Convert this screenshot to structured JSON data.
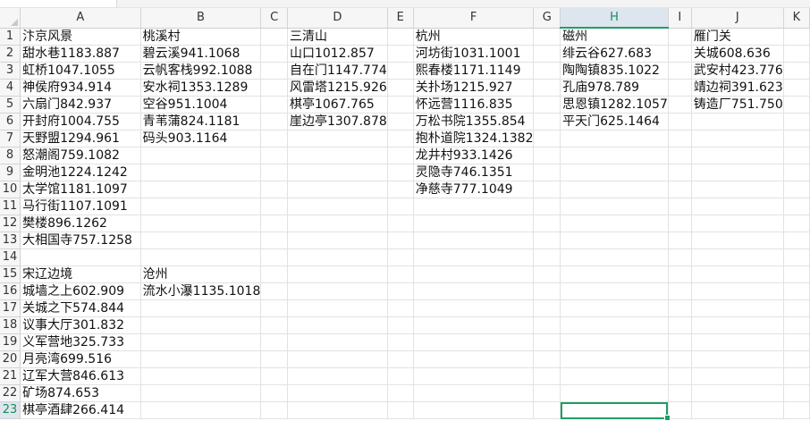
{
  "columns": [
    "A",
    "B",
    "C",
    "D",
    "E",
    "F",
    "G",
    "H",
    "I",
    "J",
    "K"
  ],
  "rows": [
    "1",
    "2",
    "3",
    "4",
    "5",
    "6",
    "7",
    "8",
    "9",
    "10",
    "11",
    "12",
    "13",
    "14",
    "15",
    "16",
    "17",
    "18",
    "19",
    "20",
    "21",
    "22",
    "23"
  ],
  "active_cell": "H23",
  "cells": {
    "A1": "汴京风景",
    "B1": "桃溪村",
    "D1": "三清山",
    "F1": "杭州",
    "H1": "磁州",
    "J1": "雁门关",
    "A2": "甜水巷1183.887",
    "B2": "碧云溪941.1068",
    "D2": "山口1012.857",
    "F2": "河坊街1031.1001",
    "H2": "绯云谷627.683",
    "J2": "关城608.636",
    "A3": "虹桥1047.1055",
    "B3": "云帆客栈992.1088",
    "D3": "自在门1147.774",
    "F3": "熙春楼1171.1149",
    "H3": "陶陶镇835.1022",
    "J3": "武安村423.776",
    "A4": "神侯府934.914",
    "B4": "安水祠1353.1289",
    "D4": "风雷塔1215.926",
    "F4": "关扑场1215.927",
    "H4": "孔庙978.789",
    "J4": "靖边祠391.623",
    "A5": "六扇门842.937",
    "B5": "空谷951.1004",
    "D5": "棋亭1067.765",
    "F5": "怀远营1116.835",
    "H5": "思恩镇1282.1057",
    "J5": "铸造厂751.750",
    "A6": "开封府1004.755",
    "B6": "青苇蒲824.1181",
    "D6": "崖边亭1307.878",
    "F6": "万松书院1355.854",
    "H6": "平天门625.1464",
    "A7": "天野盟1294.961",
    "B7": "码头903.1164",
    "F7": "抱朴道院1324.1382",
    "A8": "怒潮阁759.1082",
    "F8": "龙井村933.1426",
    "A9": "金明池1224.1242",
    "F9": "灵隐寺746.1351",
    "A10": "太学馆1181.1097",
    "F10": "净慈寺777.1049",
    "A11": "马行街1107.1091",
    "A12": "樊楼896.1262",
    "A13": "大相国寺757.1258",
    "A15": "宋辽边境",
    "B15": "沧州",
    "A16": "城墙之上602.909",
    "B16": "流水小瀑1135.1018",
    "A17": "关城之下574.844",
    "A18": "议事大厅301.832",
    "A19": "义军营地325.733",
    "A20": "月亮湾699.516",
    "A21": "辽军大营846.613",
    "A22": "矿场874.653",
    "A23": "棋亭酒肆266.414"
  }
}
